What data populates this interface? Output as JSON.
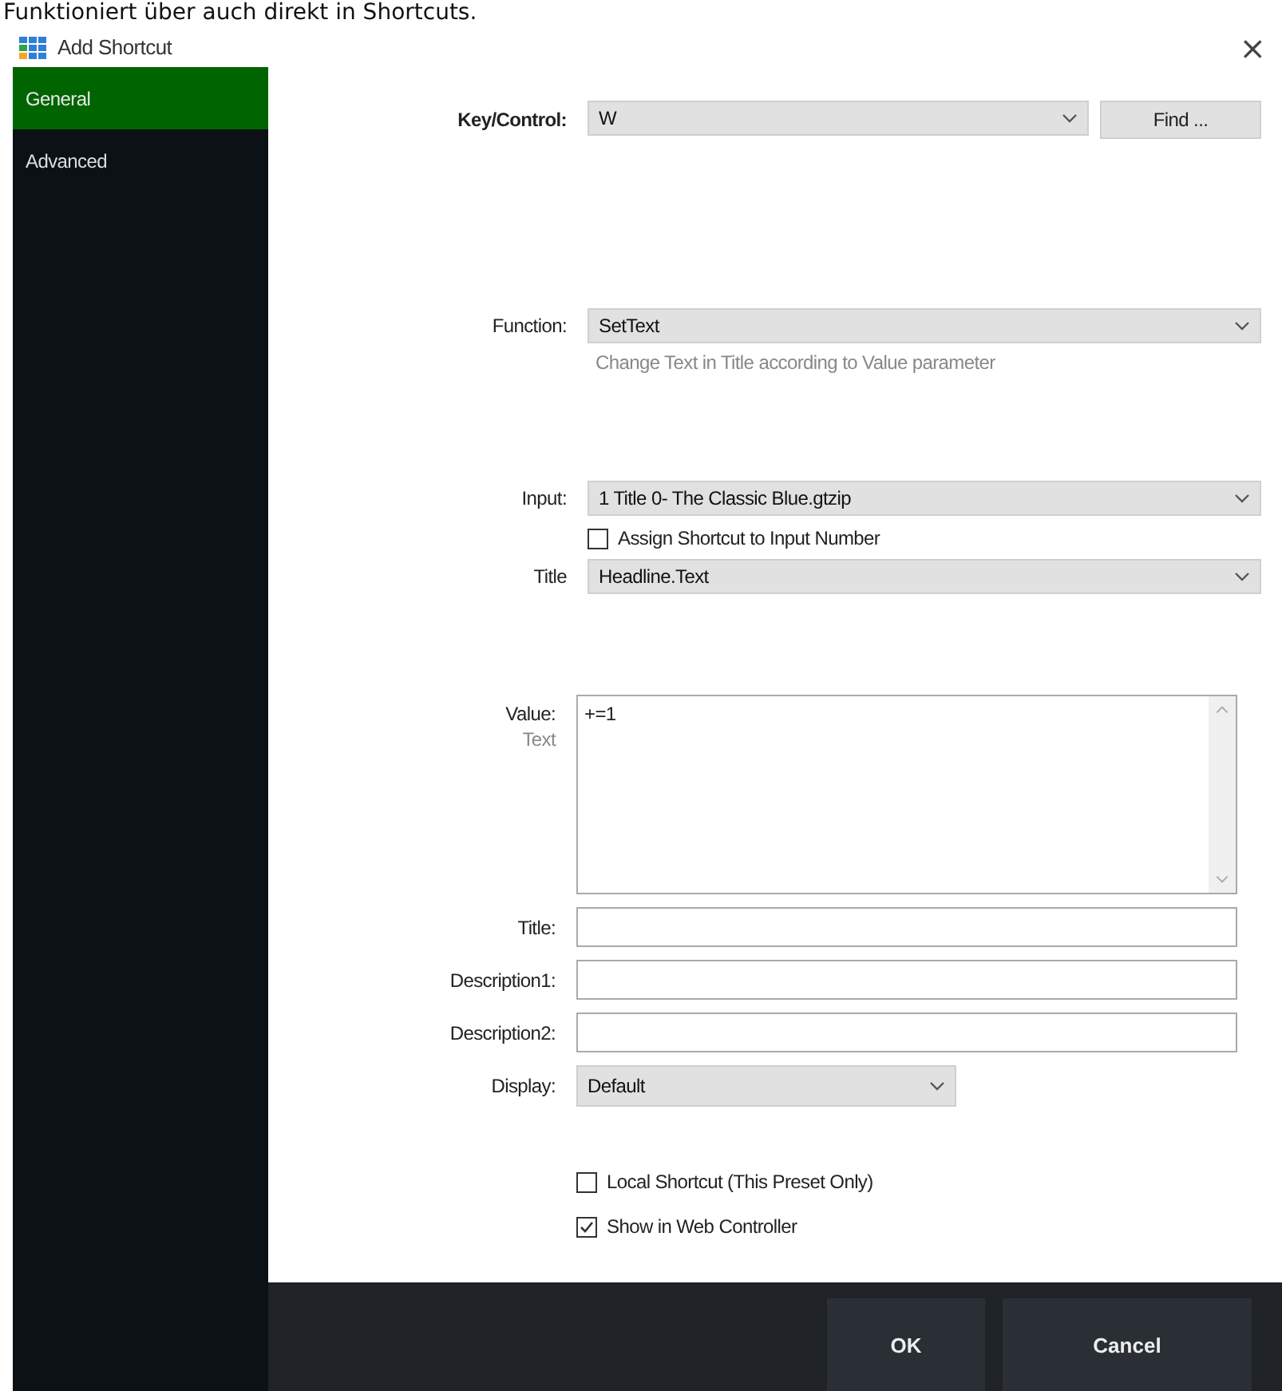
{
  "caption": "Funktioniert über auch direkt in Shortcuts.",
  "window": {
    "title": "Add Shortcut",
    "close": "×"
  },
  "sidebar": {
    "items": [
      {
        "label": "General",
        "selected": true
      },
      {
        "label": "Advanced",
        "selected": false
      }
    ]
  },
  "form": {
    "key_control": {
      "label": "Key/Control:",
      "value": "W",
      "button": "Find ..."
    },
    "function": {
      "label": "Function:",
      "value": "SetText",
      "hint": "Change Text in Title according to Value parameter"
    },
    "input": {
      "label": "Input:",
      "value": "1 Title 0- The Classic Blue.gtzip",
      "checkbox": {
        "label": "Assign Shortcut to Input Number",
        "checked": false
      }
    },
    "title_select": {
      "label": "Title",
      "value": "Headline.Text"
    },
    "value": {
      "label": "Value:",
      "sublabel": "Text",
      "value": "+=1"
    },
    "fields": [
      {
        "label": "Title:"
      },
      {
        "label": "Description1:"
      },
      {
        "label": "Description2:"
      }
    ],
    "display": {
      "label": "Display:",
      "value": "Default"
    },
    "options": [
      {
        "label": "Local Shortcut (This Preset Only)",
        "checked": false
      },
      {
        "label": "Show in Web Controller",
        "checked": true
      }
    ]
  },
  "buttons": [
    "OK",
    "Cancel"
  ]
}
